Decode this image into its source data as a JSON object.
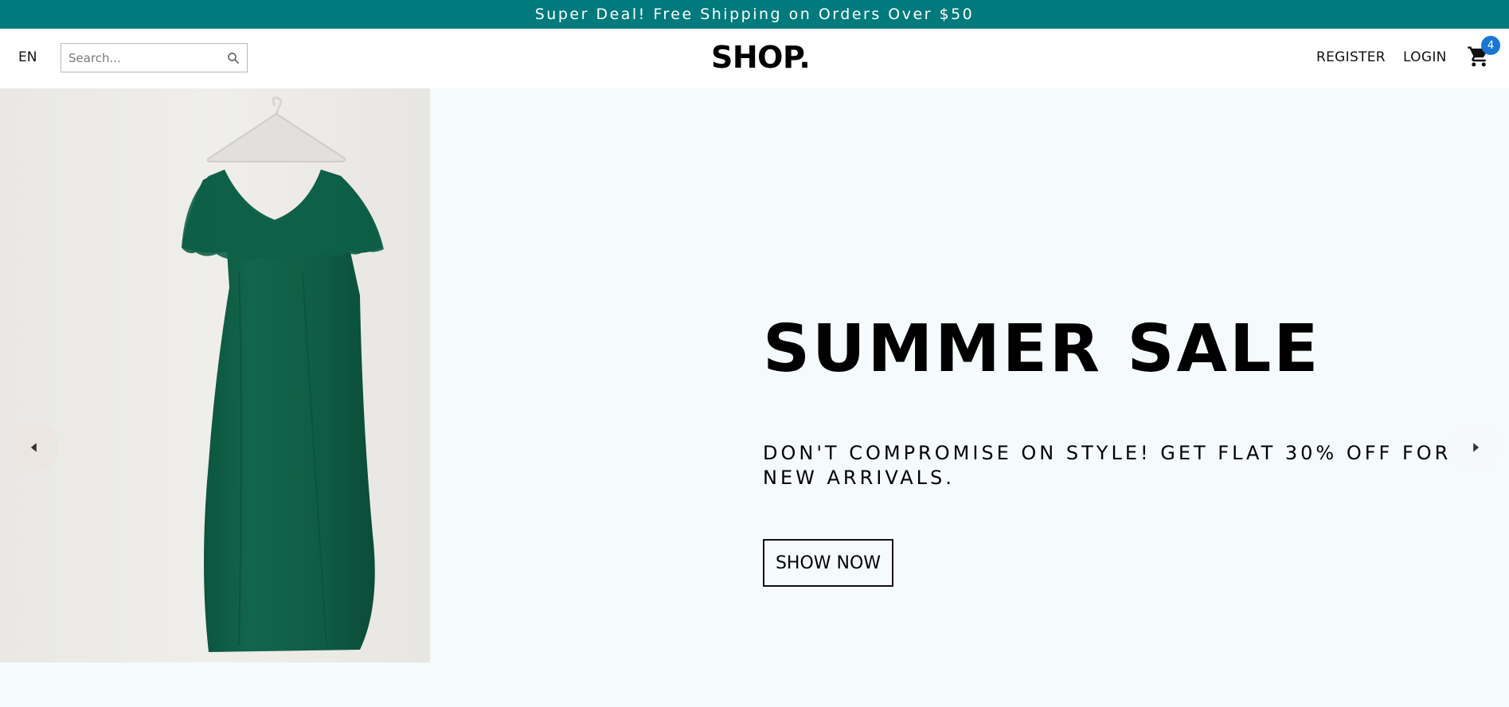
{
  "announcement": {
    "text": "Super Deal! Free Shipping on Orders Over $50"
  },
  "navbar": {
    "language": "EN",
    "search": {
      "placeholder": "Search..."
    },
    "logo": "SHOP.",
    "links": {
      "register": "REGISTER",
      "login": "LOGIN"
    },
    "cart": {
      "count": "4"
    }
  },
  "hero": {
    "title": "SUMMER SALE",
    "description": "DON'T COMPROMISE ON STYLE! GET FLAT 30% OFF FOR NEW ARRIVALS.",
    "button_label": "SHOW NOW"
  },
  "colors": {
    "announcement_bg": "#007a7c",
    "page_bg": "#f5fafd",
    "badge": "#1976d2",
    "dress": "#0f5c44"
  },
  "icons": {
    "search": "search-icon",
    "cart": "cart-icon",
    "arrow_left": "arrow-left-icon",
    "arrow_right": "arrow-right-icon"
  }
}
